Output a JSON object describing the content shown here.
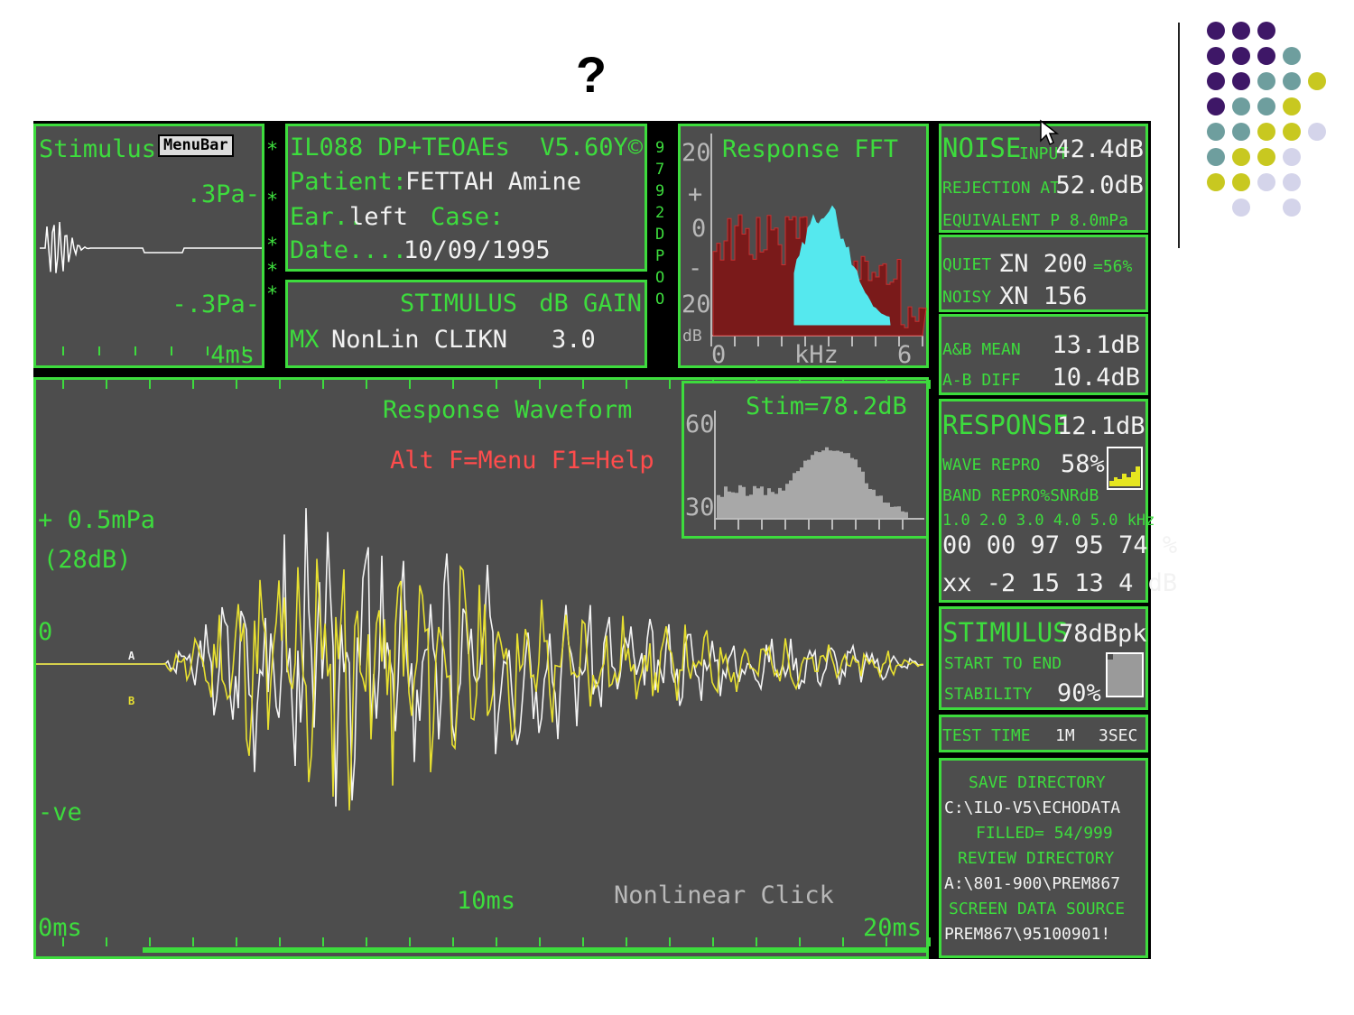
{
  "slide": {
    "title": "?",
    "dot_colors": [
      "#3e1767",
      "#6e9e9e",
      "#c8c820",
      "#d4d4ea"
    ]
  },
  "stimulus_panel": {
    "title": "Stimulus",
    "menubar": "MenuBar",
    "pos_label": ".3Pa-",
    "neg_label": "-.3Pa-",
    "time_label": "4ms",
    "markers": [
      "*",
      "*",
      "*",
      "*",
      "*"
    ]
  },
  "info_panel": {
    "line1": "IL088 DP+TEOAEs",
    "version": "V5.60Y©",
    "patient_label": "Patient:",
    "patient_name": "FETTAH Amine",
    "ear_label": "Ear..",
    "ear_value": "left",
    "case_label": "Case:",
    "date_label": "Date....",
    "date_value": "10/09/1995"
  },
  "serial": [
    "9",
    "7",
    "9",
    "2",
    "D",
    "P",
    "O",
    "O"
  ],
  "stim_gain_panel": {
    "header_stim": "STIMULUS",
    "header_gain": "dB GAIN",
    "row_mode": "MX",
    "row_type": "NonLin CLIKN",
    "row_gain": "3.0"
  },
  "fft_panel": {
    "title": "Response FFT",
    "y_top": "20",
    "y_plus": "+",
    "y_zero": "0",
    "y_minus": "-",
    "y_bottom": "20",
    "y_unit": "dB",
    "x_start": "0",
    "x_unit": "kHz",
    "x_end": "6"
  },
  "noise_panel": {
    "noise_label": "NOISE",
    "input_label": "INPUT",
    "input_value": "42.4dB",
    "rejection_label": "REJECTION AT",
    "rejection_value": "52.0dB",
    "equivalent_label": "EQUIVALENT P 8.0mPa"
  },
  "quiet_panel": {
    "quiet_label": "QUIET",
    "quiet_value": "ΣN 200",
    "quiet_pct": "=56%",
    "noisy_label": "NOISY",
    "noisy_value": "XN 156"
  },
  "mean_panel": {
    "mean_label": "A&B MEAN",
    "mean_value": "13.1dB",
    "diff_label": "A-B DIFF",
    "diff_value": "10.4dB"
  },
  "response_panel": {
    "response_label": "RESPONSE",
    "response_value": "12.1dB",
    "wave_repro_label": "WAVE REPRO",
    "wave_repro_value": "58%",
    "band_label": "BAND REPRO%SNRdB",
    "freqs": "1.0 2.0 3.0 4.0 5.0 kHz",
    "repro_row": "00 00 97 95 74 %",
    "snr_row": "xx -2 15 13  4 dB"
  },
  "stimulus_stat_panel": {
    "label": "STIMULUS",
    "value": "78dBpk",
    "start_end": "START TO END",
    "stability_label": "STABILITY",
    "stability_value": "90%"
  },
  "test_time_panel": {
    "label": "TEST TIME",
    "minutes": "1M",
    "seconds": "3SEC"
  },
  "directory_panel": {
    "save_label": "SAVE DIRECTORY",
    "save_path": "C:\\ILO-V5\\ECHODATA",
    "filled": "FILLED= 54/999",
    "review_label": "REVIEW DIRECTORY",
    "review_path": "A:\\801-900\\PREM867",
    "source_label": "SCREEN DATA SOURCE",
    "source_path": "PREM867\\95100901!"
  },
  "waveform_panel": {
    "title": "Response Waveform",
    "help": "Alt F=Menu F1=Help",
    "pos_label": "+ 0.5mPa",
    "db_label": "(28dB)",
    "zero_label": "0",
    "neg_label": "-ve",
    "trace_a": "A",
    "trace_b": "B",
    "x_start": "0ms",
    "x_mid": "10ms",
    "x_end": "20ms",
    "footer": "Nonlinear Click"
  },
  "stim_spectrum": {
    "title": "Stim=78.2dB",
    "y_top": "60",
    "y_bottom": "30"
  }
}
